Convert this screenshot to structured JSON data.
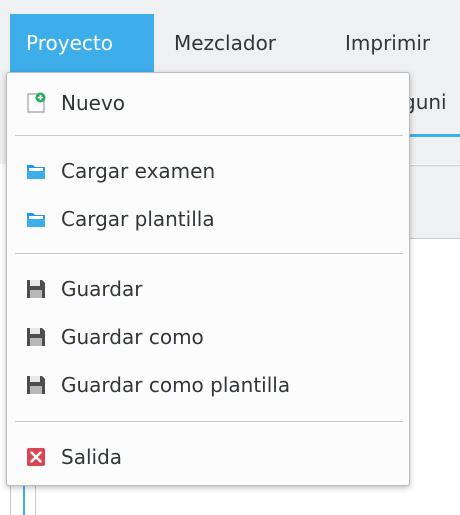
{
  "menubar": {
    "items": [
      {
        "label": "Proyecto"
      },
      {
        "label": "Mezclador"
      },
      {
        "label": "Imprimir"
      }
    ]
  },
  "background": {
    "tab_fragment": "guni"
  },
  "menu": {
    "nuevo": "Nuevo",
    "cargar_examen": "Cargar examen",
    "cargar_plantilla": "Cargar plantilla",
    "guardar": "Guardar",
    "guardar_como": "Guardar como",
    "guardar_como_plantilla": "Guardar como plantilla",
    "salida": "Salida"
  },
  "icons": {
    "nuevo": "new-document-icon",
    "cargar_examen": "folder-open-icon",
    "cargar_plantilla": "folder-open-icon",
    "guardar": "floppy-disk-icon",
    "guardar_como": "floppy-disk-icon",
    "guardar_como_plantilla": "floppy-disk-icon",
    "salida": "exit-icon"
  },
  "colors": {
    "accent": "#3daee9",
    "menubar_bg": "#eff0f1",
    "text": "#31363b",
    "exit_red": "#da4453"
  }
}
